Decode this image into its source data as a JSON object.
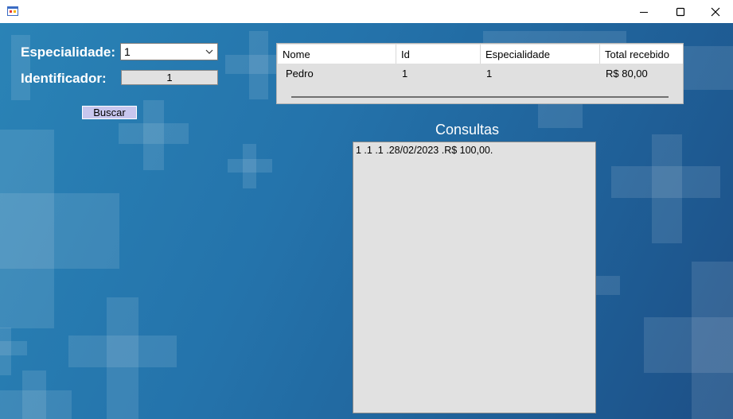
{
  "window": {
    "controls": {
      "minimize": "—",
      "maximize": "☐",
      "close": "✕"
    }
  },
  "form": {
    "especialidade_label": "Especialidade:",
    "especialidade_value": "1",
    "identificador_label": "Identificador:",
    "identificador_value": "1",
    "buscar_label": "Buscar"
  },
  "grid": {
    "columns": [
      "Nome",
      "Id",
      "Especialidade",
      "Total recebido"
    ],
    "rows": [
      [
        "Pedro",
        "1",
        "1",
        "R$ 80,00"
      ]
    ]
  },
  "consultas": {
    "title": "Consultas",
    "items": [
      "1 .1 .1 .28/02/2023 .R$ 100,00."
    ]
  }
}
